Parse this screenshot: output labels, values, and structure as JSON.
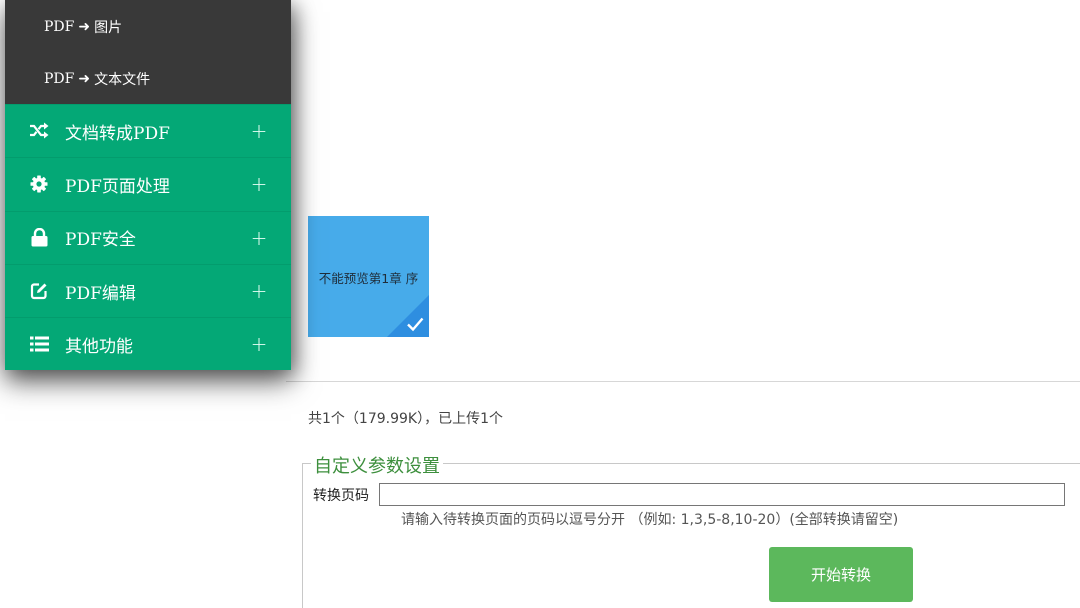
{
  "sidebar": {
    "submenu": [
      {
        "prefix": "PDF",
        "suffix": "图片"
      },
      {
        "prefix": "PDF",
        "suffix": "文本文件"
      }
    ],
    "items": [
      {
        "label": "文档转成PDF",
        "icon": "shuffle-icon",
        "expand": "+"
      },
      {
        "label": "PDF页面处理",
        "icon": "gear-icon",
        "expand": "+"
      },
      {
        "label": "PDF安全",
        "icon": "lock-icon",
        "expand": "+"
      },
      {
        "label": "PDF编辑",
        "icon": "edit-icon",
        "expand": "+"
      },
      {
        "label": "其他功能",
        "icon": "list-icon",
        "expand": "+"
      }
    ],
    "colors": {
      "submenu_bg": "#393939",
      "menu_bg": "#04a876"
    }
  },
  "file": {
    "thumbnail_text": "不能预览第1章 序",
    "icon": "checkmark-icon",
    "colors": {
      "tile": "#47abea",
      "corner": "#2e8ee0"
    }
  },
  "stats": {
    "text": "共1个（179.99K），已上传1个"
  },
  "settings": {
    "legend": "自定义参数设置",
    "page_label": "转换页码",
    "page_value": "",
    "hint": "请输入待转换页面的页码以逗号分开 （例如: 1,3,5-8,10-20）(全部转换请留空)",
    "start_button": "开始转换",
    "colors": {
      "legend": "#3d8f3d",
      "button": "#5cb85c"
    }
  }
}
